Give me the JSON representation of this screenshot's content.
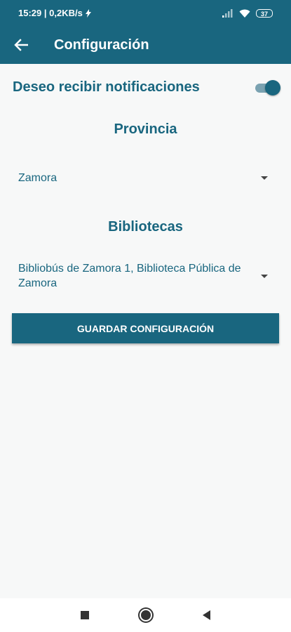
{
  "status_bar": {
    "time_speed": "15:29 | 0,2KB/s",
    "battery": "37"
  },
  "app_bar": {
    "title": "Configuración",
    "icons": {
      "back": "arrow-back-icon"
    }
  },
  "notifications": {
    "label": "Deseo recibir notificaciones",
    "enabled": true
  },
  "province": {
    "title": "Provincia",
    "selected": "Zamora"
  },
  "libraries": {
    "title": "Bibliotecas",
    "selected": "Bibliobús de Zamora 1, Biblioteca Pública de Zamora"
  },
  "actions": {
    "save_label": "GUARDAR CONFIGURACIÓN"
  },
  "colors": {
    "primary": "#19667f",
    "toggle_track": "#7aa2b1",
    "background": "#f7f8f8"
  }
}
